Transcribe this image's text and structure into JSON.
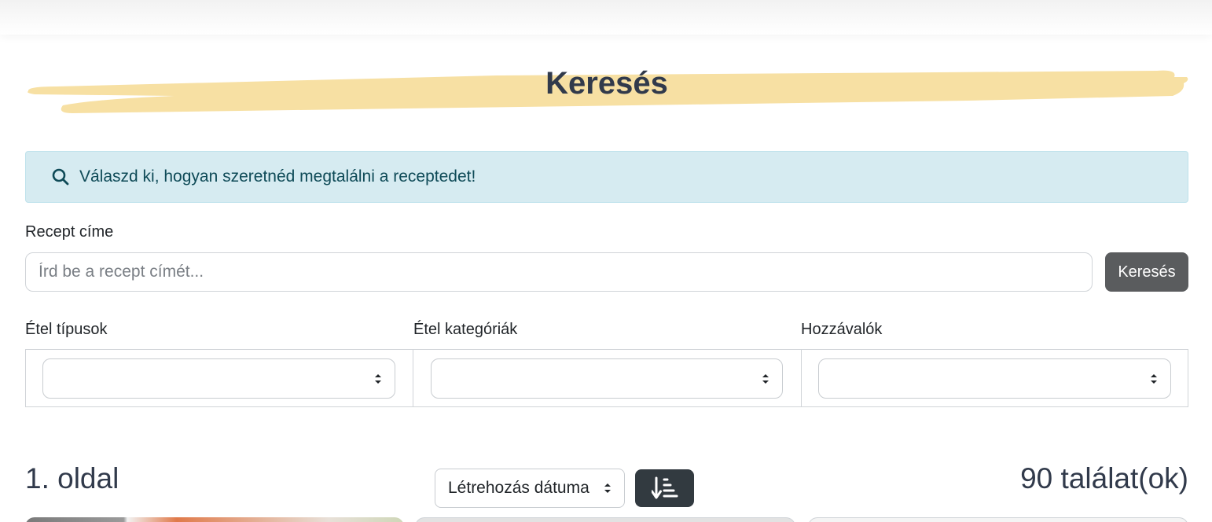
{
  "page": {
    "title": "Keresés",
    "highlight_color": "#f7e0a3"
  },
  "alert": {
    "icon": "search-icon",
    "text": "Válaszd ki, hogyan szeretnéd megtalálni a receptedet!",
    "background": "#d6ebf1"
  },
  "search": {
    "label": "Recept címe",
    "value": "",
    "placeholder": "Írd be a recept címét...",
    "button_label": "Keresés"
  },
  "filters": [
    {
      "label": "Étel típusok",
      "selected": ""
    },
    {
      "label": "Étel kategóriák",
      "selected": ""
    },
    {
      "label": "Hozzávalók",
      "selected": ""
    }
  ],
  "results": {
    "page_label": "1. oldal",
    "sort_by": "Létrehozás dátuma",
    "sort_order_icon": "sort-descending-icon",
    "count_label": "90 találat(ok)"
  }
}
